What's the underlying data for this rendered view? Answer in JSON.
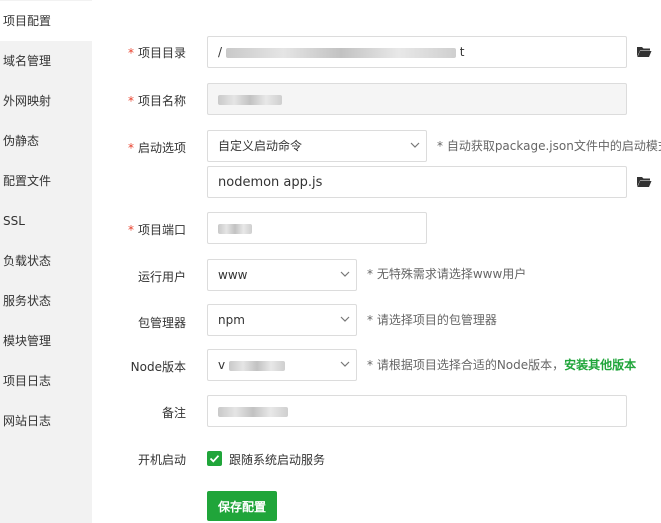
{
  "sidebar": {
    "items": [
      {
        "label": "项目配置"
      },
      {
        "label": "域名管理"
      },
      {
        "label": "外网映射"
      },
      {
        "label": "伪静态"
      },
      {
        "label": "配置文件"
      },
      {
        "label": "SSL"
      },
      {
        "label": "负载状态"
      },
      {
        "label": "服务状态"
      },
      {
        "label": "模块管理"
      },
      {
        "label": "项目日志"
      },
      {
        "label": "网站日志"
      }
    ]
  },
  "form": {
    "project_dir": {
      "label": "项目目录",
      "value_prefix": "/",
      "value_suffix": "t"
    },
    "project_name": {
      "label": "项目名称"
    },
    "start_option": {
      "label": "启动选项",
      "selected": "自定义启动命令",
      "hint": "* 自动获取package.json文件中的启动模式",
      "command": "nodemon app.js"
    },
    "project_port": {
      "label": "项目端口"
    },
    "run_user": {
      "label": "运行用户",
      "selected": "www",
      "hint": "* 无特殊需求请选择www用户"
    },
    "package_manager": {
      "label": "包管理器",
      "selected": "npm",
      "hint": "* 请选择项目的包管理器"
    },
    "node_version": {
      "label": "Node版本",
      "selected_prefix": "v",
      "hint": "* 请根据项目选择合适的Node版本，",
      "hint_link": "安装其他版本"
    },
    "remark": {
      "label": "备注"
    },
    "autostart": {
      "label": "开机启动",
      "checkbox_label": "跟随系统启动服务",
      "checked": true
    },
    "save_label": "保存配置"
  },
  "colors": {
    "accent": "#20a53a",
    "required": "#e8412c"
  }
}
